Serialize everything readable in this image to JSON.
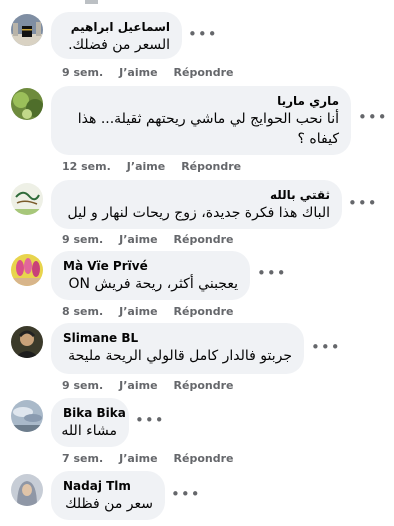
{
  "comments": [
    {
      "author": "اسماعيل ابراهيم",
      "text": "السعر من فضلك.",
      "age": "9 sem.",
      "like": "J’aime",
      "reply": "Répondre",
      "more_icon": "ellipsis-icon",
      "avatar_icon": "kaaba-photo"
    },
    {
      "author": "ماري ماريا",
      "text": "أنا نحب الحوايج لي ماشي ريحتهم ثقيلة... هذا كيفاه ؟",
      "age": "12 sem.",
      "like": "J’aime",
      "reply": "Répondre",
      "more_icon": "ellipsis-icon",
      "avatar_icon": "greenery-photo"
    },
    {
      "author": "ثقتي بالله",
      "text": "الباك هذا فكرة جديدة، زوج ريحات لنهار و ليل",
      "age": "9 sem.",
      "like": "J’aime",
      "reply": "Répondre",
      "more_icon": "ellipsis-icon",
      "avatar_icon": "calligraphy-photo"
    },
    {
      "author": "Mà Vïe Prïvé",
      "text": "يعجبني أكثر، ريحة فريش ON",
      "age": "8 sem.",
      "like": "J’aime",
      "reply": "Répondre",
      "more_icon": "ellipsis-icon",
      "avatar_icon": "nails-photo"
    },
    {
      "author": "Slimane BL",
      "text": "جربتو فالدار كامل قالولي الريحة مليحة",
      "age": "9 sem.",
      "like": "J’aime",
      "reply": "Répondre",
      "more_icon": "ellipsis-icon",
      "avatar_icon": "portrait-photo"
    },
    {
      "author": "Bika Bika",
      "text": "مشاء الله",
      "age": "7 sem.",
      "like": "J’aime",
      "reply": "Répondre",
      "more_icon": "ellipsis-icon",
      "avatar_icon": "sky-photo"
    },
    {
      "author": "Nadaj Tlm",
      "text": "سعر من فظلك",
      "age": "",
      "like": "",
      "reply": "",
      "more_icon": "ellipsis-icon",
      "avatar_icon": "veiled-woman-photo"
    }
  ],
  "colors": {
    "bubble": "#f0f2f5",
    "meta_text": "#65676b",
    "body_text": "#050505"
  }
}
